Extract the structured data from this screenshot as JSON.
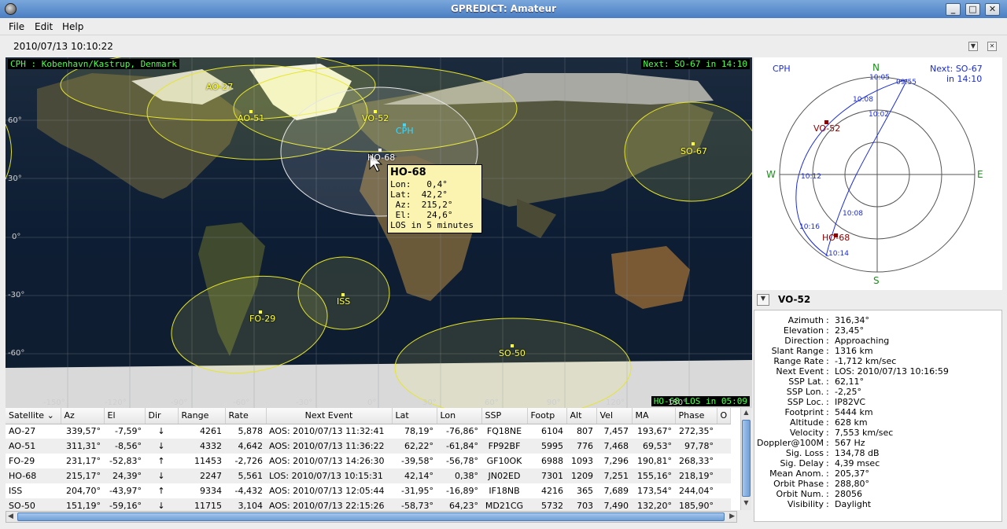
{
  "window": {
    "title": "GPREDICT: Amateur"
  },
  "menu": {
    "file": "File",
    "edit": "Edit",
    "help": "Help"
  },
  "timebar": {
    "time": "2010/07/13 10:10:22"
  },
  "map": {
    "qth_label": "CPH : Kobenhavn/Kastrup, Denmark",
    "next_label": "Next: SO-67 in 14:10",
    "los_label": "HO-68 LOS in 05:09",
    "qth_marker": "CPH",
    "lat_labels": [
      "60°",
      "30°",
      "0°",
      "-30°",
      "-60°"
    ],
    "lon_labels": [
      "-150°",
      "-120°",
      "-90°",
      "-60°",
      "-30°",
      "0°",
      "30°",
      "60°",
      "90°",
      "120°",
      "150°"
    ],
    "satellites": [
      "AO-27",
      "AO-51",
      "VO-52",
      "HO-68",
      "SO-67",
      "FO-29",
      "ISS",
      "SO-50"
    ],
    "tooltip": {
      "title": "HO-68",
      "lon": "Lon:   0,4°",
      "lat": "Lat:  42,2°",
      "az": " Az:  215,2°",
      "el": " El:   24,6°",
      "los": "LOS in 5 minutes"
    }
  },
  "polar": {
    "qth": "CPH",
    "next": "Next: SO-67",
    "next_time": "in 14:10",
    "n": "N",
    "s": "S",
    "e": "E",
    "w": "W",
    "times": [
      "10:05",
      "09:55",
      "10:08",
      "10:02",
      "10:12",
      "10:08",
      "10:16",
      "10:14"
    ],
    "sats": [
      "VO-52",
      "HO-68"
    ]
  },
  "info": {
    "title": "VO-52",
    "rows": [
      {
        "k": "Azimuth",
        "v": "316,34°"
      },
      {
        "k": "Elevation",
        "v": " 23,45°"
      },
      {
        "k": "Direction",
        "v": "Approaching"
      },
      {
        "k": "Slant Range",
        "v": "1316 km"
      },
      {
        "k": "Range Rate",
        "v": "-1,712 km/sec"
      },
      {
        "k": "Next Event",
        "v": "LOS: 2010/07/13 10:16:59"
      },
      {
        "k": "SSP Lat.",
        "v": "62,11°"
      },
      {
        "k": "SSP Lon.",
        "v": "-2,25°"
      },
      {
        "k": "SSP Loc.",
        "v": "IP82VC"
      },
      {
        "k": "Footprint",
        "v": "5444 km"
      },
      {
        "k": "Altitude",
        "v": "628 km"
      },
      {
        "k": "Velocity",
        "v": "7,553 km/sec"
      },
      {
        "k": "Doppler@100M",
        "v": "567 Hz"
      },
      {
        "k": "Sig. Loss",
        "v": "134,78 dB"
      },
      {
        "k": "Sig. Delay",
        "v": "4,39 msec"
      },
      {
        "k": "Mean Anom.",
        "v": "205,37°"
      },
      {
        "k": "Orbit Phase",
        "v": "288,80°"
      },
      {
        "k": "Orbit Num.",
        "v": "28056"
      },
      {
        "k": "Visibility",
        "v": "Daylight"
      }
    ]
  },
  "table": {
    "headers": [
      "Satellite",
      "Az",
      "El",
      "Dir",
      "Range",
      "Rate",
      "Next Event",
      "Lat",
      "Lon",
      "SSP",
      "Footp",
      "Alt",
      "Vel",
      "MA",
      "Phase",
      "O"
    ],
    "rows": [
      [
        "AO-27",
        "339,57°",
        "-7,59°",
        "↓",
        "4261",
        "5,878",
        "AOS: 2010/07/13 11:32:41",
        "78,19°",
        "-76,86°",
        "FQ18NE",
        "6104",
        "807",
        "7,457",
        "193,67°",
        "272,35°"
      ],
      [
        "AO-51",
        "311,31°",
        "-8,56°",
        "↓",
        "4332",
        "4,642",
        "AOS: 2010/07/13 11:36:22",
        "62,22°",
        "-61,84°",
        "FP92BF",
        "5995",
        "776",
        "7,468",
        "69,53°",
        "97,78°"
      ],
      [
        "FO-29",
        "231,17°",
        "-52,83°",
        "↑",
        "11453",
        "-2,726",
        "AOS: 2010/07/13 14:26:30",
        "-39,58°",
        "-56,78°",
        "GF10OK",
        "6988",
        "1093",
        "7,296",
        "190,81°",
        "268,33°"
      ],
      [
        "HO-68",
        "215,17°",
        "24,39°",
        "↓",
        "2247",
        "5,561",
        "LOS: 2010/07/13 10:15:31",
        "42,14°",
        "0,38°",
        "JN02ED",
        "7301",
        "1209",
        "7,251",
        "155,16°",
        "218,19°"
      ],
      [
        "ISS",
        "204,70°",
        "-43,97°",
        "↑",
        "9334",
        "-4,432",
        "AOS: 2010/07/13 12:05:44",
        "-31,95°",
        "-16,89°",
        "IF18NB",
        "4216",
        "365",
        "7,689",
        "173,54°",
        "244,04°"
      ],
      [
        "SO-50",
        "151,19°",
        "-59,16°",
        "↓",
        "11715",
        "3,104",
        "AOS: 2010/07/13 22:15:26",
        "-58,73°",
        "64,23°",
        "MD21CG",
        "5732",
        "703",
        "7,490",
        "132,20°",
        "185,90°"
      ]
    ]
  }
}
